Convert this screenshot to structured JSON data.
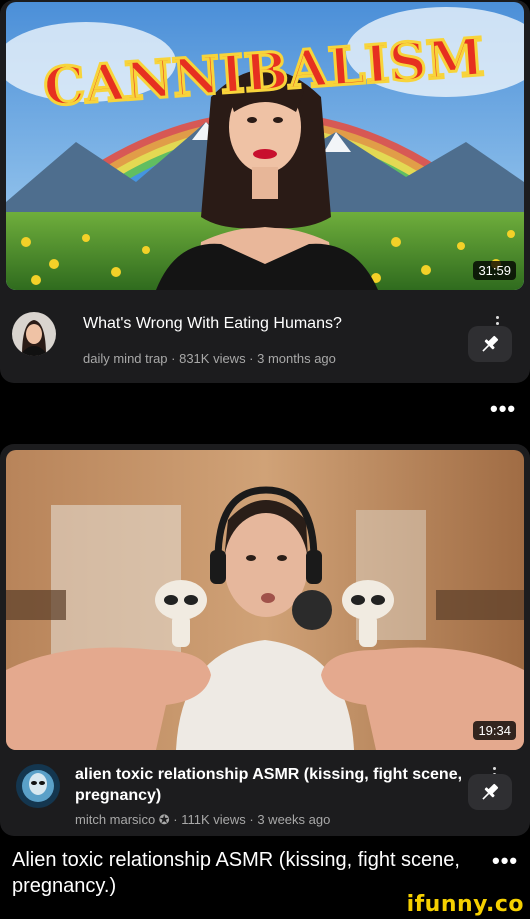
{
  "video1": {
    "thumbnail_text": "CANNIBALISM",
    "duration": "31:59",
    "title": "What's Wrong With Eating Humans?",
    "meta": "daily mind trap · 831K views · 3 months ago",
    "avatar_icon": "woman-portrait-avatar",
    "pin_icon": "pin-icon"
  },
  "between_menu": "•••",
  "video2": {
    "duration": "19:34",
    "title": "alien toxic relationship ASMR (kissing, fight scene, pregnancy)",
    "meta": "mitch marsico ✪ · 111K views · 3 weeks ago",
    "avatar_icon": "alien-avatar",
    "pin_icon": "pin-icon"
  },
  "post": {
    "caption": "Alien toxic relationship ASMR (kissing, fight scene, pregnancy.)",
    "menu": "•••"
  },
  "watermark": "ifunny.co",
  "colors": {
    "card": "#1c1c1e",
    "meta": "#a8a8a8",
    "logo": "#f5d000"
  }
}
